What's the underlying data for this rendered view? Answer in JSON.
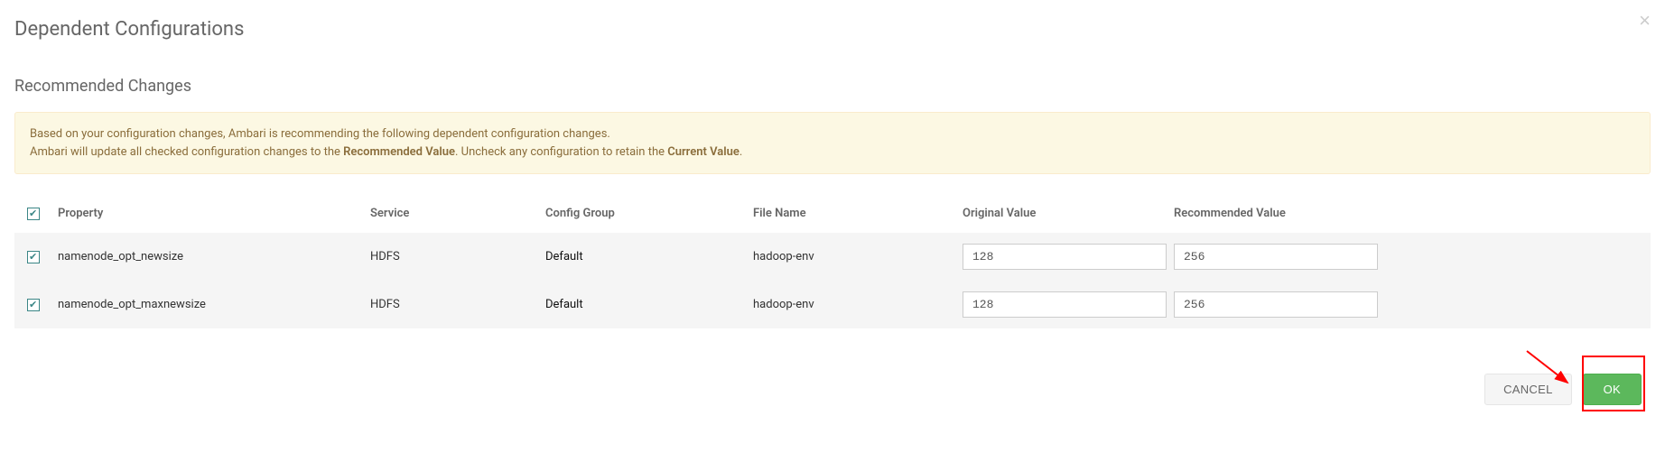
{
  "modal": {
    "title": "Dependent Configurations",
    "subtitle": "Recommended Changes",
    "close_label": "×"
  },
  "alert": {
    "line1": "Based on your configuration changes, Ambari is recommending the following dependent configuration changes.",
    "line2_a": "Ambari will update all checked configuration changes to the ",
    "line2_bold1": "Recommended Value",
    "line2_b": ". Uncheck any configuration to retain the ",
    "line2_bold2": "Current Value",
    "line2_c": "."
  },
  "table": {
    "headers": {
      "property": "Property",
      "service": "Service",
      "config_group": "Config Group",
      "filename": "File Name",
      "original": "Original Value",
      "recommended": "Recommended Value"
    },
    "rows": [
      {
        "checked": true,
        "property": "namenode_opt_newsize",
        "service": "HDFS",
        "config_group": "Default",
        "filename": "hadoop-env",
        "original": "128",
        "recommended": "256"
      },
      {
        "checked": true,
        "property": "namenode_opt_maxnewsize",
        "service": "HDFS",
        "config_group": "Default",
        "filename": "hadoop-env",
        "original": "128",
        "recommended": "256"
      }
    ]
  },
  "footer": {
    "cancel": "CANCEL",
    "ok": "OK"
  }
}
